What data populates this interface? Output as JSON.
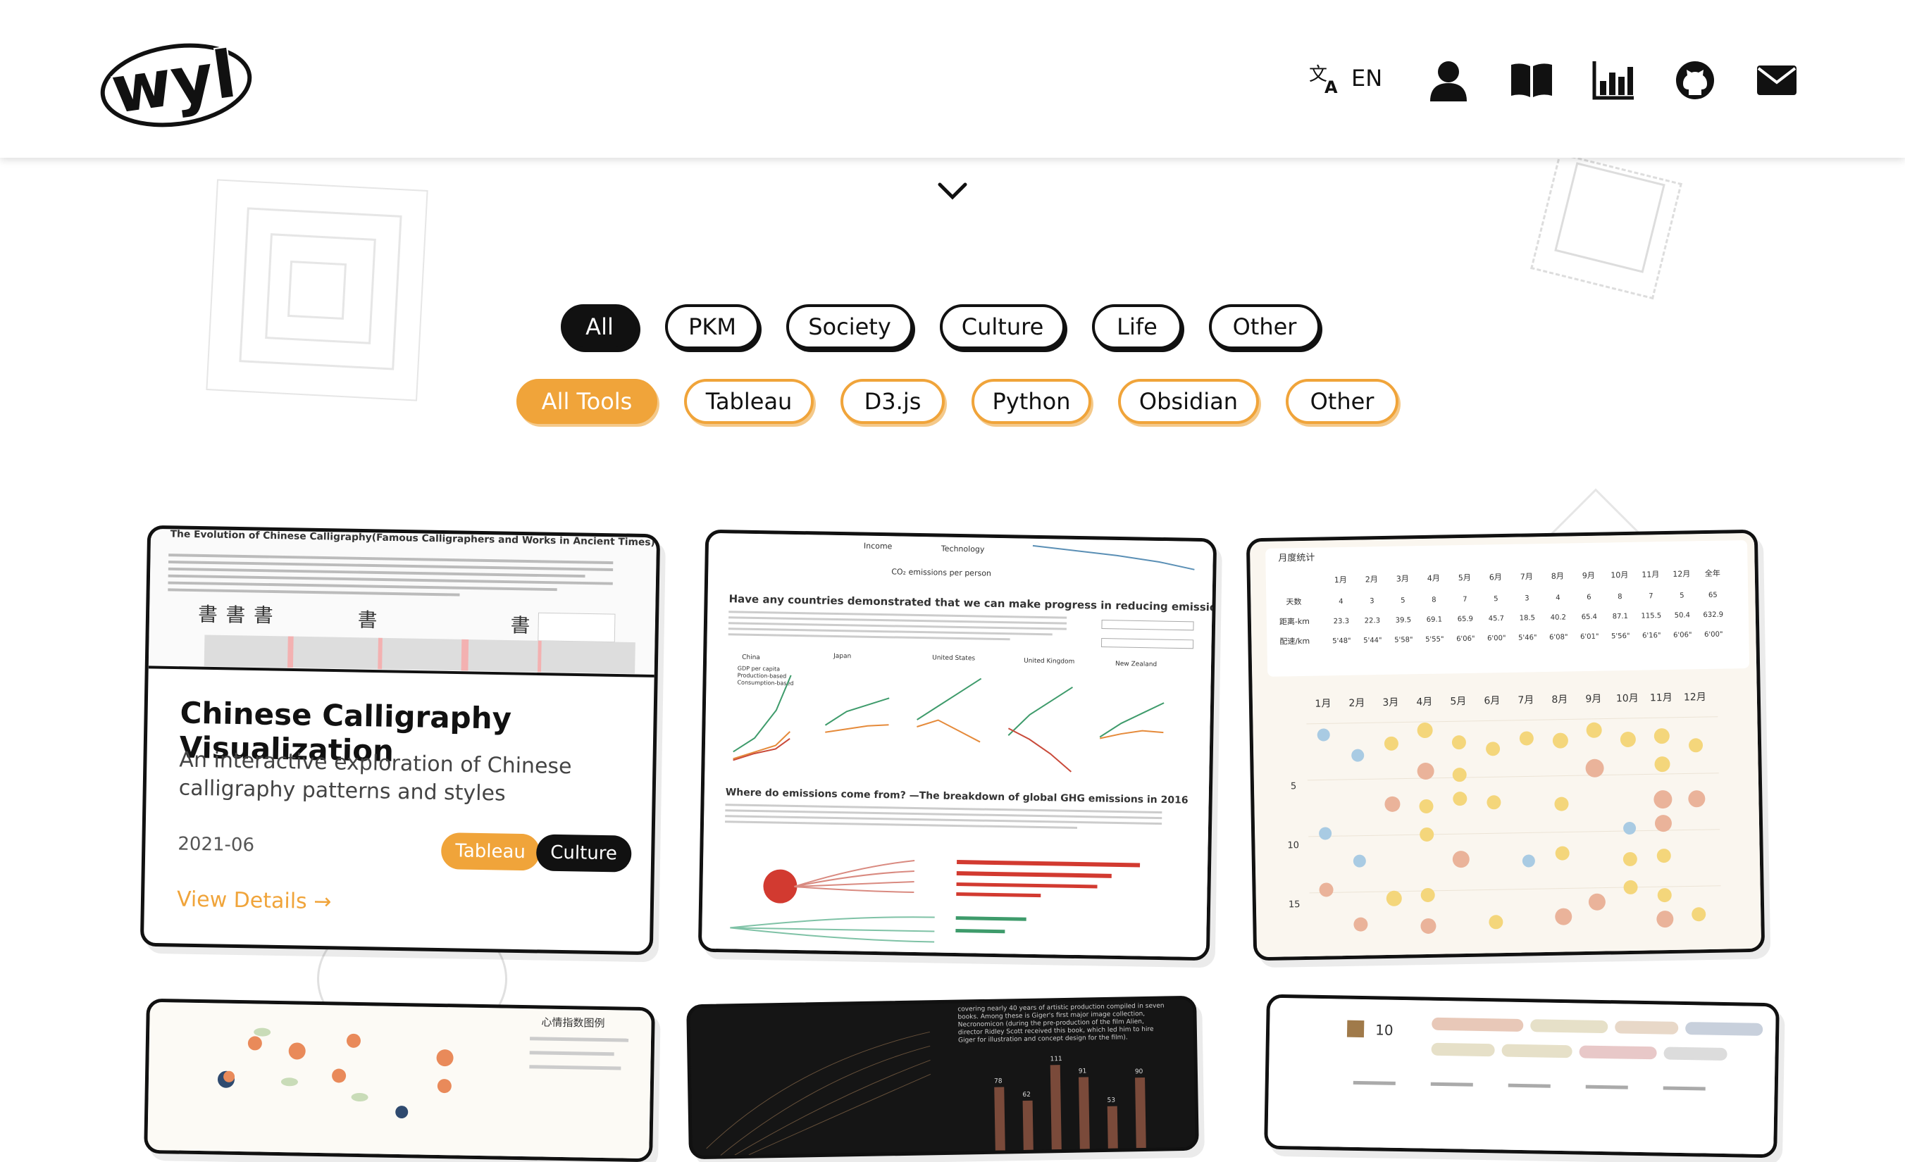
{
  "header": {
    "logo_text": "wyl",
    "language_label": "EN",
    "icons": [
      "translate-icon",
      "user-icon",
      "book-icon",
      "chart-icon",
      "github-icon",
      "mail-icon"
    ]
  },
  "filters": {
    "categories": [
      "All",
      "PKM",
      "Society",
      "Culture",
      "Life",
      "Other"
    ],
    "active_category": "All",
    "tools": [
      "All Tools",
      "Tableau",
      "D3.js",
      "Python",
      "Obsidian",
      "Other"
    ],
    "active_tool": "All Tools"
  },
  "cards": {
    "featured": {
      "title": "Chinese Calligraphy Visualization",
      "description": "An interactive exploration of Chinese calligraphy patterns and styles",
      "date": "2021-06",
      "tags": [
        "Tableau",
        "Culture"
      ],
      "view_label": "View Details",
      "thumb_heading": "The Evolution of Chinese Calligraphy(Famous Calligraphers and Works in Ancient Times)"
    },
    "emissions": {
      "heading1": "Have any countries demonstrated that we can make progress in reducing emissions?",
      "heading2": "Where do emissions come from? —The breakdown of global GHG emissions in 2016",
      "countries": [
        "China",
        "Japan",
        "United States",
        "United Kingdom",
        "New Zealand"
      ],
      "legend": [
        "GDP per capita",
        "Production-based",
        "Consumption-based"
      ],
      "top_labels": [
        "Income",
        "Technology",
        "CO₂ emissions per person"
      ]
    },
    "running": {
      "title": "月度统计",
      "months": [
        "1月",
        "2月",
        "3月",
        "4月",
        "5月",
        "6月",
        "7月",
        "8月",
        "9月",
        "10月",
        "11月",
        "12月",
        "全年"
      ],
      "rows": [
        {
          "label": "天数",
          "values": [
            "4",
            "3",
            "5",
            "8",
            "7",
            "5",
            "3",
            "4",
            "6",
            "8",
            "7",
            "5",
            "65"
          ]
        },
        {
          "label": "距离-km",
          "values": [
            "23.3",
            "22.3",
            "39.5",
            "69.1",
            "65.9",
            "45.7",
            "18.5",
            "40.2",
            "65.4",
            "87.1",
            "115.5",
            "50.4",
            "632.9"
          ]
        },
        {
          "label": "配速/km",
          "values": [
            "5'48\"",
            "5'44\"",
            "5'58\"",
            "5'55\"",
            "6'06\"",
            "6'00\"",
            "5'46\"",
            "6'08\"",
            "6'01\"",
            "5'56\"",
            "6'16\"",
            "6'06\"",
            "6'00\""
          ]
        }
      ],
      "grid_months": [
        "1月",
        "2月",
        "3月",
        "4月",
        "5月",
        "6月",
        "7月",
        "8月",
        "9月",
        "10月",
        "11月",
        "12月"
      ],
      "y_ticks": [
        "5",
        "10",
        "15"
      ]
    },
    "mood": {
      "legend_title": "心情指数图例"
    },
    "dark": {
      "caption": "covering nearly 40 years of artistic production compiled in seven books. Among these is Giger's first major image collection, Necronomicon (during the pre-production of the film Alien, director Ridley Scott received this book, which led him to hire Giger for illustration and concept design for the film).",
      "bar_labels": [
        "78",
        "62",
        "111",
        "91",
        "53",
        "90"
      ]
    },
    "stats": {
      "count": "10"
    }
  }
}
